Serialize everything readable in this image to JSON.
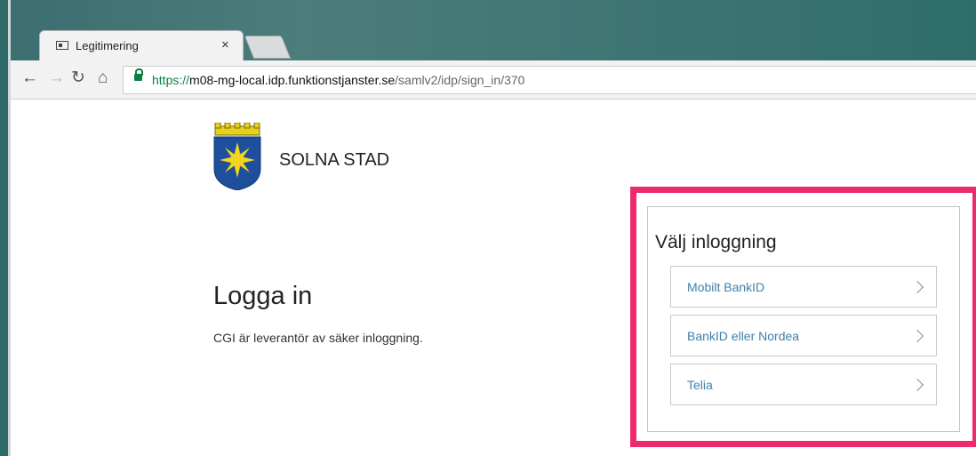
{
  "browser": {
    "tab_title": "Legitimering",
    "tab_close": "×",
    "url": {
      "scheme": "https://",
      "host": "m08-mg-local.idp.funktionstjanster.se",
      "path": "/samlv2/idp/sign_in/370"
    }
  },
  "page": {
    "org_name": "SOLNA STAD",
    "heading": "Logga in",
    "subtext": "CGI är leverantör av säker inloggning.",
    "login_panel": {
      "title": "Välj inloggning",
      "options": [
        {
          "label": "Mobilt BankID"
        },
        {
          "label": "BankID eller Nordea"
        },
        {
          "label": "Telia"
        }
      ]
    }
  },
  "colors": {
    "highlight": "#ee2a6a",
    "link": "#3d7fa9",
    "secure": "#0b8043"
  }
}
